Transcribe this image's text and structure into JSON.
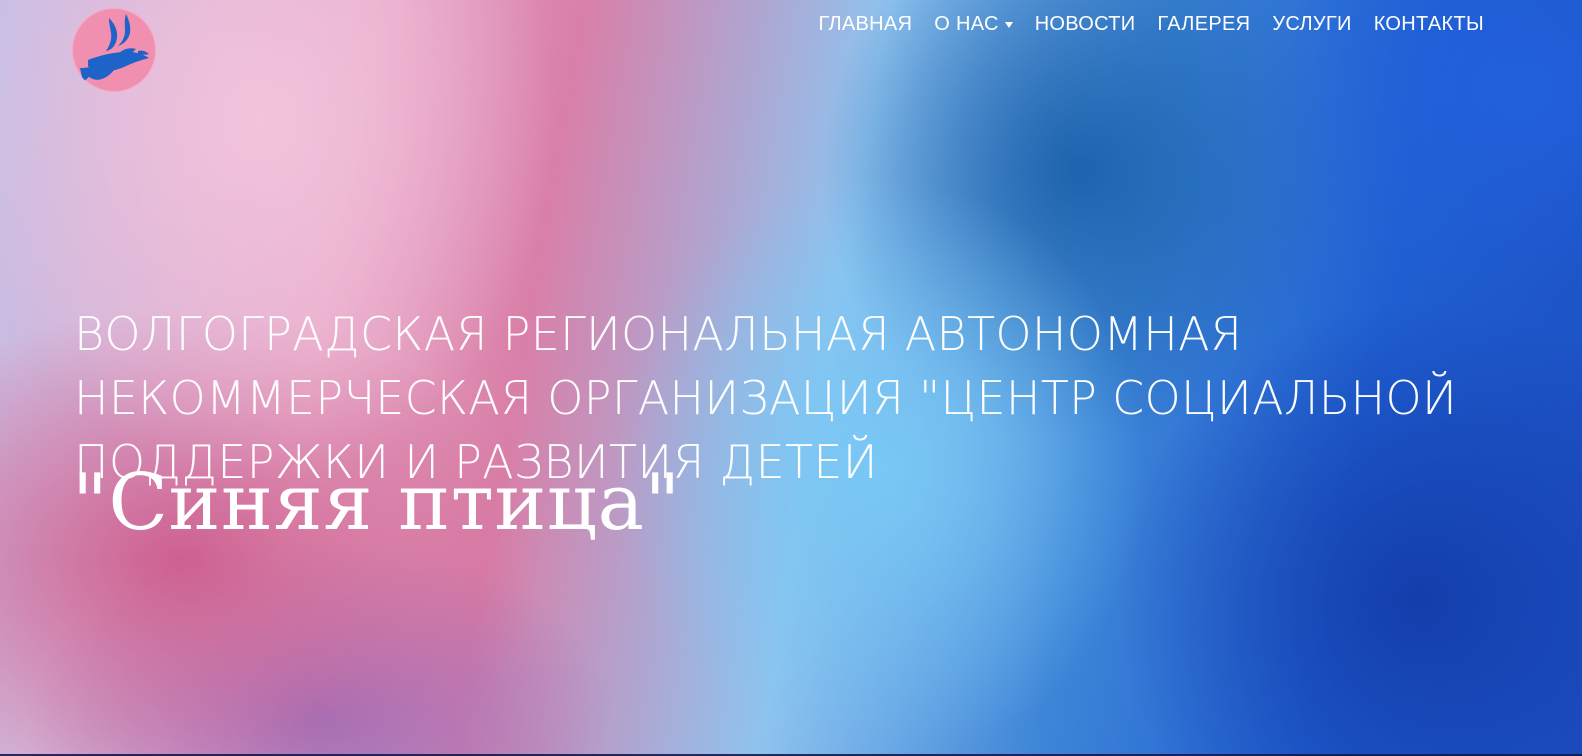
{
  "logo": {
    "icon": "bird-icon",
    "background": "#f18fb0",
    "bird_color": "#1d63c8"
  },
  "nav": {
    "items": [
      {
        "label": "ГЛАВНАЯ"
      },
      {
        "label": "О НАС",
        "has_dropdown": true
      },
      {
        "label": "НОВОСТИ"
      },
      {
        "label": "ГАЛЕРЕЯ"
      },
      {
        "label": "УСЛУГИ"
      },
      {
        "label": "КОНТАКТЫ"
      }
    ]
  },
  "hero": {
    "headline_lines": [
      "ВОЛГОГРАДСКАЯ РЕГИОНАЛЬНАЯ АВТОНОМНАЯ",
      "НЕКОММЕРЧЕСКАЯ ОРГАНИЗАЦИЯ \"ЦЕНТР СОЦИАЛЬНОЙ",
      "ПОДДЕРЖКИ И РАЗВИТИЯ ДЕТЕЙ"
    ],
    "brand_name": "\"Синяя птица\""
  },
  "colors": {
    "text": "#ffffff",
    "pink": "#e7aac9",
    "magenta": "#d97fa8",
    "sky": "#8fc3ef",
    "blue": "#1f5fd2"
  }
}
